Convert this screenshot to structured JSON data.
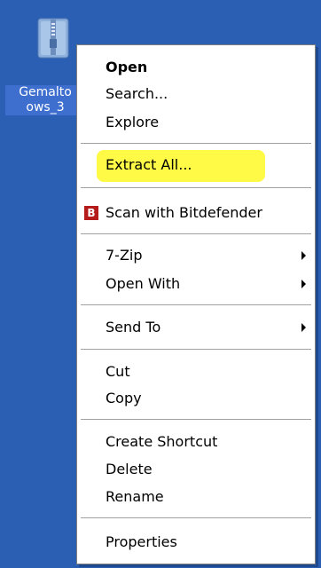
{
  "desktop": {
    "icon_label_line1": "Gemalto",
    "icon_label_line2": "ows_3",
    "icon": "zip-folder-icon"
  },
  "context_menu": {
    "items": [
      {
        "label": "Open"
      },
      {
        "label": "Search..."
      },
      {
        "label": "Explore"
      },
      {
        "label": "Extract All..."
      },
      {
        "label": "Scan with Bitdefender",
        "icon": "bitdefender-icon",
        "icon_text": "B"
      },
      {
        "label": "7-Zip"
      },
      {
        "label": "Open With"
      },
      {
        "label": "Send To"
      },
      {
        "label": "Cut"
      },
      {
        "label": "Copy"
      },
      {
        "label": "Create Shortcut"
      },
      {
        "label": "Delete"
      },
      {
        "label": "Rename"
      },
      {
        "label": "Properties"
      }
    ]
  },
  "colors": {
    "desktop_bg": "#2a5fb4",
    "selection_bg": "#3e6fcf",
    "highlight": "#fffa3c",
    "bitdefender": "#b51b1b"
  }
}
